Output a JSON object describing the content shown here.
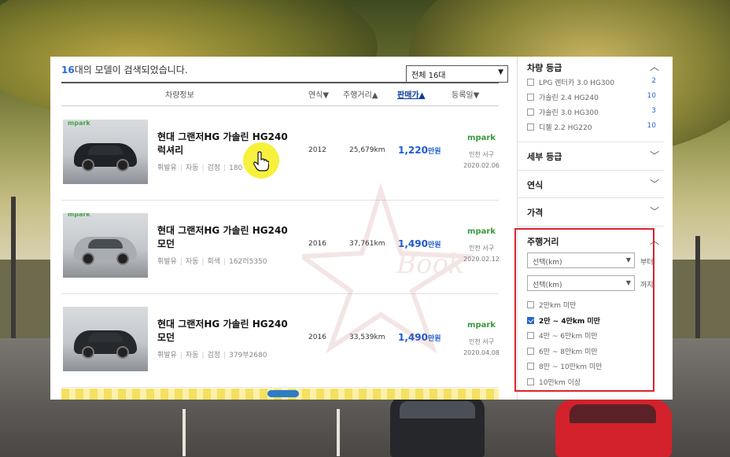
{
  "result": {
    "count": "16",
    "count_suffix": "대의 모델이 검색되었습니다.",
    "filter_select": "전체 16대"
  },
  "columns": {
    "info": "차량정보",
    "year": "연식",
    "mileage": "주행거리",
    "price": "판매가",
    "registered": "등록일"
  },
  "listings": [
    {
      "title_line1": "현대 그랜저HG 가솔린 HG240",
      "title_line2": "럭셔리",
      "fuel": "휘발유",
      "trans": "자동",
      "color": "검정",
      "plate": "180",
      "year": "2012",
      "mileage": "25,679km",
      "price": "1,220",
      "price_unit": "만원",
      "dealer": "mpark",
      "location": "인천 서구",
      "date": "2020.02.06",
      "photo_logo": "mpark",
      "car_color": "#1f2226"
    },
    {
      "title_line1": "현대 그랜저HG 가솔린 HG240",
      "title_line2": "모던",
      "fuel": "휘발유",
      "trans": "자동",
      "color": "회색",
      "plate": "162러5350",
      "year": "2016",
      "mileage": "37,761km",
      "price": "1,490",
      "price_unit": "만원",
      "dealer": "mpark",
      "location": "인천 서구",
      "date": "2020.02.12",
      "photo_logo": "mpark",
      "car_color": "#a9adb2"
    },
    {
      "title_line1": "현대 그랜저HG 가솔린 HG240",
      "title_line2": "모던",
      "fuel": "휘발유",
      "trans": "자동",
      "color": "검정",
      "plate": "379부2680",
      "year": "2016",
      "mileage": "33,539km",
      "price": "1,490",
      "price_unit": "만원",
      "dealer": "mpark",
      "location": "인천 서구",
      "date": "2020.04.08",
      "photo_logo": "",
      "car_color": "#25292d"
    }
  ],
  "sidebar": {
    "grade": {
      "title": "차량 등급",
      "options": [
        {
          "label": "LPG 렌터카 3.0 HG300",
          "count": "2"
        },
        {
          "label": "가솔린 2.4 HG240",
          "count": "10"
        },
        {
          "label": "가솔린 3.0 HG300",
          "count": "3"
        },
        {
          "label": "디젤 2.2 HG220",
          "count": "10"
        }
      ]
    },
    "detail_grade": "세부 등급",
    "year": "연식",
    "price": "가격",
    "mileage": {
      "title": "주행거리",
      "from_select": "선택(km)",
      "from_suffix": "부터",
      "to_select": "선택(km)",
      "to_suffix": "까지",
      "options": [
        {
          "label": "2만km 미만",
          "checked": false
        },
        {
          "label": "2만 ~ 4만km 미만",
          "checked": true
        },
        {
          "label": "4만 ~ 6만km 미만",
          "checked": false
        },
        {
          "label": "6만 ~ 8만km 미만",
          "checked": false
        },
        {
          "label": "8만 ~ 10만km 미만",
          "checked": false
        },
        {
          "label": "10만km 이상",
          "checked": false
        }
      ]
    }
  },
  "watermark": "Book",
  "colors": {
    "accent_blue": "#2a6ad6",
    "price_blue": "#1e5bd0",
    "dealer_green": "#3a9a3e",
    "highlight_red": "#d8242c",
    "cursor_yellow": "#f6ef1b"
  }
}
